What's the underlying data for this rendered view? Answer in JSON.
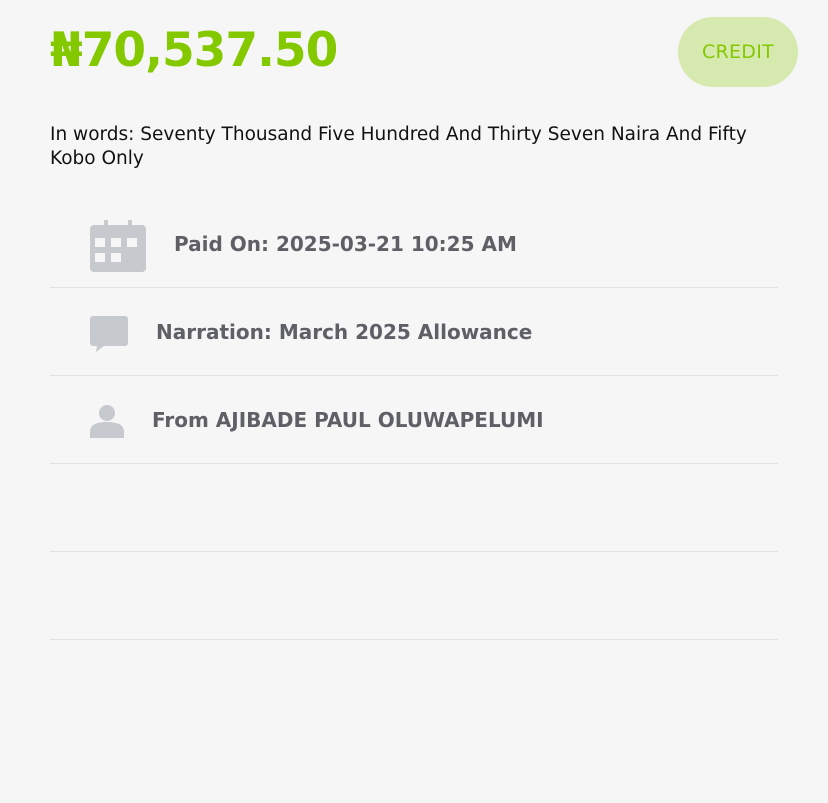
{
  "transaction": {
    "amount": "₦70,537.50",
    "type_badge": "CREDIT",
    "amount_in_words": "In words: Seventy Thousand Five Hundred And Thirty Seven Naira And Fifty Kobo Only"
  },
  "details": {
    "paid_on": "Paid On: 2025-03-21 10:25 AM",
    "narration": "Narration: March 2025 Allowance",
    "from": "From AJIBADE PAUL OLUWAPELUMI"
  },
  "icons": {
    "paid_on": "calendar-icon",
    "narration": "comment-icon",
    "from": "user-icon"
  },
  "colors": {
    "accent": "#84c800",
    "badge_bg": "#d6e9ae",
    "icon": "#c6c9ce",
    "detail_text": "#5f6066",
    "background": "#f6f6f6"
  }
}
